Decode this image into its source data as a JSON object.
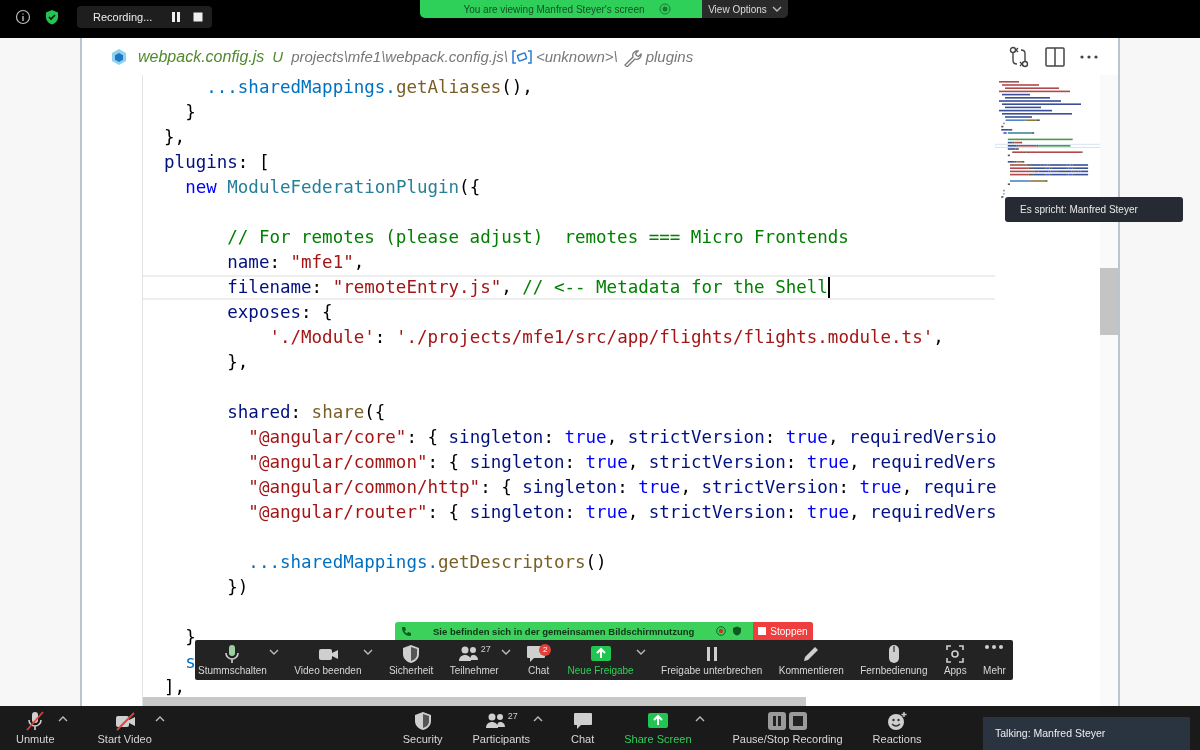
{
  "top_bar": {
    "recording_label": "Recording...",
    "viewing_banner": "You are viewing Manfred Steyer's screen",
    "view_options": "View Options"
  },
  "editor": {
    "breadcrumb": {
      "file": "webpack.config.js",
      "status": "U",
      "path": "projects\\mfe1\\webpack.config.js\\",
      "symbol": "<unknown>\\",
      "member": "plugins"
    },
    "lines": [
      {
        "kind": "code",
        "current": false,
        "tokens": [
          {
            "kind": "var",
            "text": "      ...sharedMappings."
          },
          {
            "kind": "func",
            "text": "getAliases"
          },
          {
            "kind": "plain",
            "text": "(),"
          }
        ]
      },
      {
        "kind": "code",
        "current": false,
        "tokens": [
          {
            "kind": "plain",
            "text": "    }"
          }
        ]
      },
      {
        "kind": "code",
        "current": false,
        "tokens": [
          {
            "kind": "plain",
            "text": "  },"
          }
        ]
      },
      {
        "kind": "code",
        "current": false,
        "tokens": [
          {
            "kind": "prop",
            "text": "  plugins"
          },
          {
            "kind": "plain",
            "text": ": ["
          }
        ]
      },
      {
        "kind": "code",
        "current": false,
        "tokens": [
          {
            "kind": "keyword",
            "text": "    new"
          },
          {
            "kind": "class",
            "text": " ModuleFederationPlugin"
          },
          {
            "kind": "plain",
            "text": "({"
          }
        ]
      },
      {
        "kind": "blank"
      },
      {
        "kind": "code",
        "current": false,
        "tokens": [
          {
            "kind": "comment",
            "text": "        // For remotes (please adjust)  remotes === Micro Frontends"
          }
        ]
      },
      {
        "kind": "code",
        "current": false,
        "tokens": [
          {
            "kind": "prop",
            "text": "        name"
          },
          {
            "kind": "plain",
            "text": ": "
          },
          {
            "kind": "string",
            "text": "\"mfe1\""
          },
          {
            "kind": "plain",
            "text": ","
          }
        ]
      },
      {
        "kind": "code",
        "current": true,
        "tokens": [
          {
            "kind": "prop",
            "text": "        filename"
          },
          {
            "kind": "plain",
            "text": ": "
          },
          {
            "kind": "string",
            "text": "\"remoteEntry.js\""
          },
          {
            "kind": "plain",
            "text": ", "
          },
          {
            "kind": "comment",
            "text": "// <-- Metadata for the Shell"
          }
        ]
      },
      {
        "kind": "code",
        "current": false,
        "tokens": [
          {
            "kind": "prop",
            "text": "        exposes"
          },
          {
            "kind": "plain",
            "text": ": {"
          }
        ]
      },
      {
        "kind": "code",
        "current": false,
        "tokens": [
          {
            "kind": "string",
            "text": "            './Module'"
          },
          {
            "kind": "plain",
            "text": ": "
          },
          {
            "kind": "string",
            "text": "'./projects/mfe1/src/app/flights/flights.module.ts'"
          },
          {
            "kind": "plain",
            "text": ","
          }
        ]
      },
      {
        "kind": "code",
        "current": false,
        "tokens": [
          {
            "kind": "plain",
            "text": "        },"
          }
        ]
      },
      {
        "kind": "blank"
      },
      {
        "kind": "code",
        "current": false,
        "tokens": [
          {
            "kind": "prop",
            "text": "        shared"
          },
          {
            "kind": "plain",
            "text": ": "
          },
          {
            "kind": "func",
            "text": "share"
          },
          {
            "kind": "plain",
            "text": "({"
          }
        ]
      },
      {
        "kind": "code",
        "current": false,
        "tokens": [
          {
            "kind": "string",
            "text": "          \"@angular/core\""
          },
          {
            "kind": "plain",
            "text": ": { "
          },
          {
            "kind": "prop",
            "text": "singleton"
          },
          {
            "kind": "plain",
            "text": ": "
          },
          {
            "kind": "keyword",
            "text": "true"
          },
          {
            "kind": "plain",
            "text": ", "
          },
          {
            "kind": "prop",
            "text": "strictVersion"
          },
          {
            "kind": "plain",
            "text": ": "
          },
          {
            "kind": "keyword",
            "text": "true"
          },
          {
            "kind": "plain",
            "text": ", "
          },
          {
            "kind": "prop",
            "text": "requiredVersio"
          }
        ]
      },
      {
        "kind": "code",
        "current": false,
        "tokens": [
          {
            "kind": "string",
            "text": "          \"@angular/common\""
          },
          {
            "kind": "plain",
            "text": ": { "
          },
          {
            "kind": "prop",
            "text": "singleton"
          },
          {
            "kind": "plain",
            "text": ": "
          },
          {
            "kind": "keyword",
            "text": "true"
          },
          {
            "kind": "plain",
            "text": ", "
          },
          {
            "kind": "prop",
            "text": "strictVersion"
          },
          {
            "kind": "plain",
            "text": ": "
          },
          {
            "kind": "keyword",
            "text": "true"
          },
          {
            "kind": "plain",
            "text": ", "
          },
          {
            "kind": "prop",
            "text": "requiredVers"
          }
        ]
      },
      {
        "kind": "code",
        "current": false,
        "tokens": [
          {
            "kind": "string",
            "text": "          \"@angular/common/http\""
          },
          {
            "kind": "plain",
            "text": ": { "
          },
          {
            "kind": "prop",
            "text": "singleton"
          },
          {
            "kind": "plain",
            "text": ": "
          },
          {
            "kind": "keyword",
            "text": "true"
          },
          {
            "kind": "plain",
            "text": ", "
          },
          {
            "kind": "prop",
            "text": "strictVersion"
          },
          {
            "kind": "plain",
            "text": ": "
          },
          {
            "kind": "keyword",
            "text": "true"
          },
          {
            "kind": "plain",
            "text": ", "
          },
          {
            "kind": "prop",
            "text": "require"
          }
        ]
      },
      {
        "kind": "code",
        "current": false,
        "tokens": [
          {
            "kind": "string",
            "text": "          \"@angular/router\""
          },
          {
            "kind": "plain",
            "text": ": { "
          },
          {
            "kind": "prop",
            "text": "singleton"
          },
          {
            "kind": "plain",
            "text": ": "
          },
          {
            "kind": "keyword",
            "text": "true"
          },
          {
            "kind": "plain",
            "text": ", "
          },
          {
            "kind": "prop",
            "text": "strictVersion"
          },
          {
            "kind": "plain",
            "text": ": "
          },
          {
            "kind": "keyword",
            "text": "true"
          },
          {
            "kind": "plain",
            "text": ", "
          },
          {
            "kind": "prop",
            "text": "requiredVers"
          }
        ]
      },
      {
        "kind": "blank"
      },
      {
        "kind": "code",
        "current": false,
        "tokens": [
          {
            "kind": "var",
            "text": "          ...sharedMappings."
          },
          {
            "kind": "func",
            "text": "getDescriptors"
          },
          {
            "kind": "plain",
            "text": "()"
          }
        ]
      },
      {
        "kind": "code",
        "current": false,
        "tokens": [
          {
            "kind": "plain",
            "text": "        })"
          }
        ]
      },
      {
        "kind": "blank"
      },
      {
        "kind": "code",
        "current": false,
        "tokens": [
          {
            "kind": "plain",
            "text": "    }"
          }
        ]
      },
      {
        "kind": "code",
        "current": false,
        "tokens": [
          {
            "kind": "var",
            "text": "    s"
          }
        ]
      },
      {
        "kind": "code",
        "current": false,
        "tokens": [
          {
            "kind": "plain",
            "text": "  ],"
          }
        ]
      }
    ]
  },
  "speaker_tooltip": "Es spricht: Manfred Steyer",
  "share_toolbar": {
    "banner": "Sie befinden sich in der gemeinsamen Bildschirmnutzung",
    "stop": "Stoppen",
    "items": [
      {
        "kind": "mic",
        "label": "Stummschalten",
        "caret": true,
        "accent": false
      },
      {
        "kind": "video",
        "label": "Video beenden",
        "caret": true,
        "accent": false
      },
      {
        "kind": "shield",
        "label": "Sicherheit",
        "caret": false,
        "accent": false
      },
      {
        "kind": "people",
        "label": "Teilnehmer",
        "count": "27",
        "caret": true,
        "accent": false
      },
      {
        "kind": "chat",
        "label": "Chat",
        "badge": "2",
        "caret": false,
        "accent": false
      },
      {
        "kind": "share",
        "label": "Neue Freigabe",
        "caret": true,
        "accent": true
      },
      {
        "kind": "pause",
        "label": "Freigabe unterbrechen",
        "caret": false,
        "accent": false
      },
      {
        "kind": "pencil",
        "label": "Kommentieren",
        "caret": false,
        "accent": false
      },
      {
        "kind": "mouse",
        "label": "Fernbedienung",
        "caret": false,
        "accent": false
      },
      {
        "kind": "apps",
        "label": "Apps",
        "caret": false,
        "accent": false
      },
      {
        "kind": "more",
        "label": "Mehr",
        "caret": false,
        "accent": false
      }
    ]
  },
  "bottom_bar": {
    "left_controls": [
      {
        "kind": "mic-off",
        "label": "Unmute",
        "caret": true,
        "accent": false
      },
      {
        "kind": "video-off",
        "label": "Start Video",
        "caret": true,
        "accent": false
      }
    ],
    "center_controls": [
      {
        "kind": "shield",
        "label": "Security",
        "caret": false,
        "accent": false
      },
      {
        "kind": "people",
        "label": "Participants",
        "count": "27",
        "caret": true,
        "accent": false
      },
      {
        "kind": "chat",
        "label": "Chat",
        "caret": false,
        "accent": false
      },
      {
        "kind": "share",
        "label": "Share Screen",
        "caret": true,
        "accent": true
      },
      {
        "kind": "pause-stop",
        "label": "Pause/Stop Recording",
        "caret": false,
        "accent": false
      },
      {
        "kind": "reactions",
        "label": "Reactions",
        "caret": false,
        "accent": false
      }
    ],
    "talking": "Talking: Manfred Steyer"
  }
}
